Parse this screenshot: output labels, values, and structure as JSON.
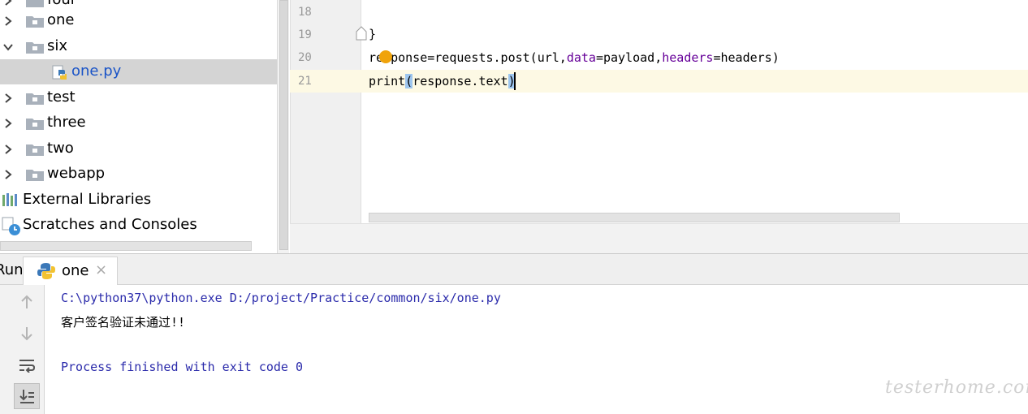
{
  "project_tree": {
    "items": [
      {
        "label": "four",
        "kind": "folder",
        "expanded": false
      },
      {
        "label": "one",
        "kind": "folder",
        "expanded": false
      },
      {
        "label": "six",
        "kind": "folder",
        "expanded": true
      },
      {
        "label": "one.py",
        "kind": "python-file",
        "selected": true
      },
      {
        "label": "test",
        "kind": "folder",
        "expanded": false
      },
      {
        "label": "three",
        "kind": "folder",
        "expanded": false
      },
      {
        "label": "two",
        "kind": "folder",
        "expanded": false
      },
      {
        "label": "webapp",
        "kind": "folder",
        "expanded": false
      },
      {
        "label": "External Libraries",
        "kind": "libraries"
      },
      {
        "label": "Scratches and Consoles",
        "kind": "scratches"
      }
    ]
  },
  "editor": {
    "line_numbers": [
      "18",
      "19",
      "20",
      "21"
    ],
    "current_line": "21",
    "lines": {
      "l19": "}",
      "l20_a": "response=requests.post(url,",
      "l20_b": "data",
      "l20_c": "=payload,",
      "l20_d": "headers",
      "l20_e": "=headers)",
      "l21_a": "print",
      "l21_b": "(",
      "l21_c": "response.text",
      "l21_d": ")"
    }
  },
  "run_panel": {
    "label": "Run:",
    "tab_label": "one",
    "tab_close": "×",
    "console_lines": [
      "C:\\python37\\python.exe D:/project/Practice/common/six/one.py",
      "客户签名验证未通过!!",
      "",
      "Process finished with exit code 0"
    ]
  },
  "watermark": "testerhome.com",
  "colors": {
    "selection": "#d4d4d4",
    "file_link": "#1a54c7",
    "keyword_arg": "#660099",
    "console_path": "#2b2bab",
    "current_line": "#fdf9e4",
    "bulb": "#f0a30a"
  }
}
